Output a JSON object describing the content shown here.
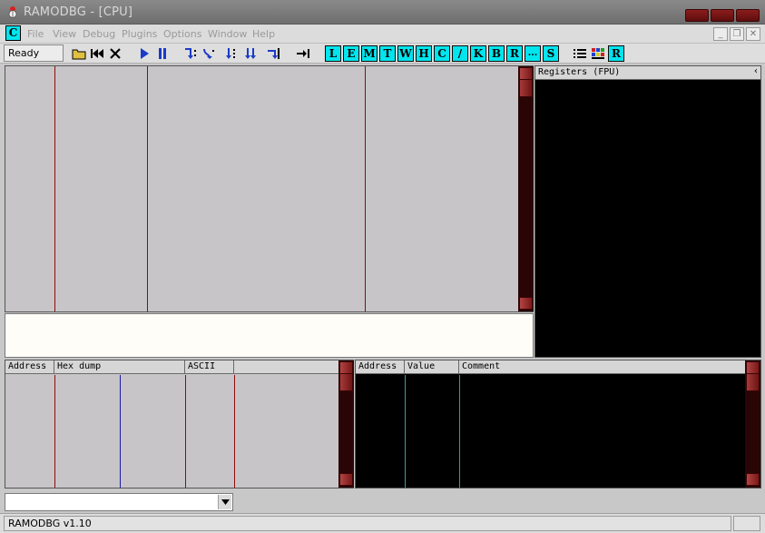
{
  "window": {
    "title": "RAMODBG - [CPU]"
  },
  "menu": {
    "items": [
      {
        "label": "File"
      },
      {
        "label": "View"
      },
      {
        "label": "Debug"
      },
      {
        "label": "Plugins"
      },
      {
        "label": "Options"
      },
      {
        "label": "Window"
      },
      {
        "label": "Help"
      }
    ],
    "cpu_badge": "C"
  },
  "toolbar": {
    "status": "Ready",
    "letters": [
      "L",
      "E",
      "M",
      "T",
      "W",
      "H",
      "C",
      "/",
      "K",
      "B",
      "R",
      "...",
      "S"
    ],
    "last_letter": "R"
  },
  "registers": {
    "title": "Registers (FPU)"
  },
  "dump": {
    "columns": [
      "Address",
      "Hex dump",
      "ASCII",
      ""
    ]
  },
  "stack": {
    "columns": [
      "Address",
      "Value",
      "Comment"
    ]
  },
  "command": {
    "value": ""
  },
  "statusbar": {
    "text": "RAMODBG v1.10"
  },
  "colors": {
    "accent": "#00e5ee",
    "scroll": "#8c1d1d",
    "pane_dark": "#000000",
    "pane_light": "#c8c5c8",
    "separator_red": "#8b0d0d",
    "separator_blue": "#1a1aa8",
    "separator_cyan": "#3a9aa0"
  }
}
